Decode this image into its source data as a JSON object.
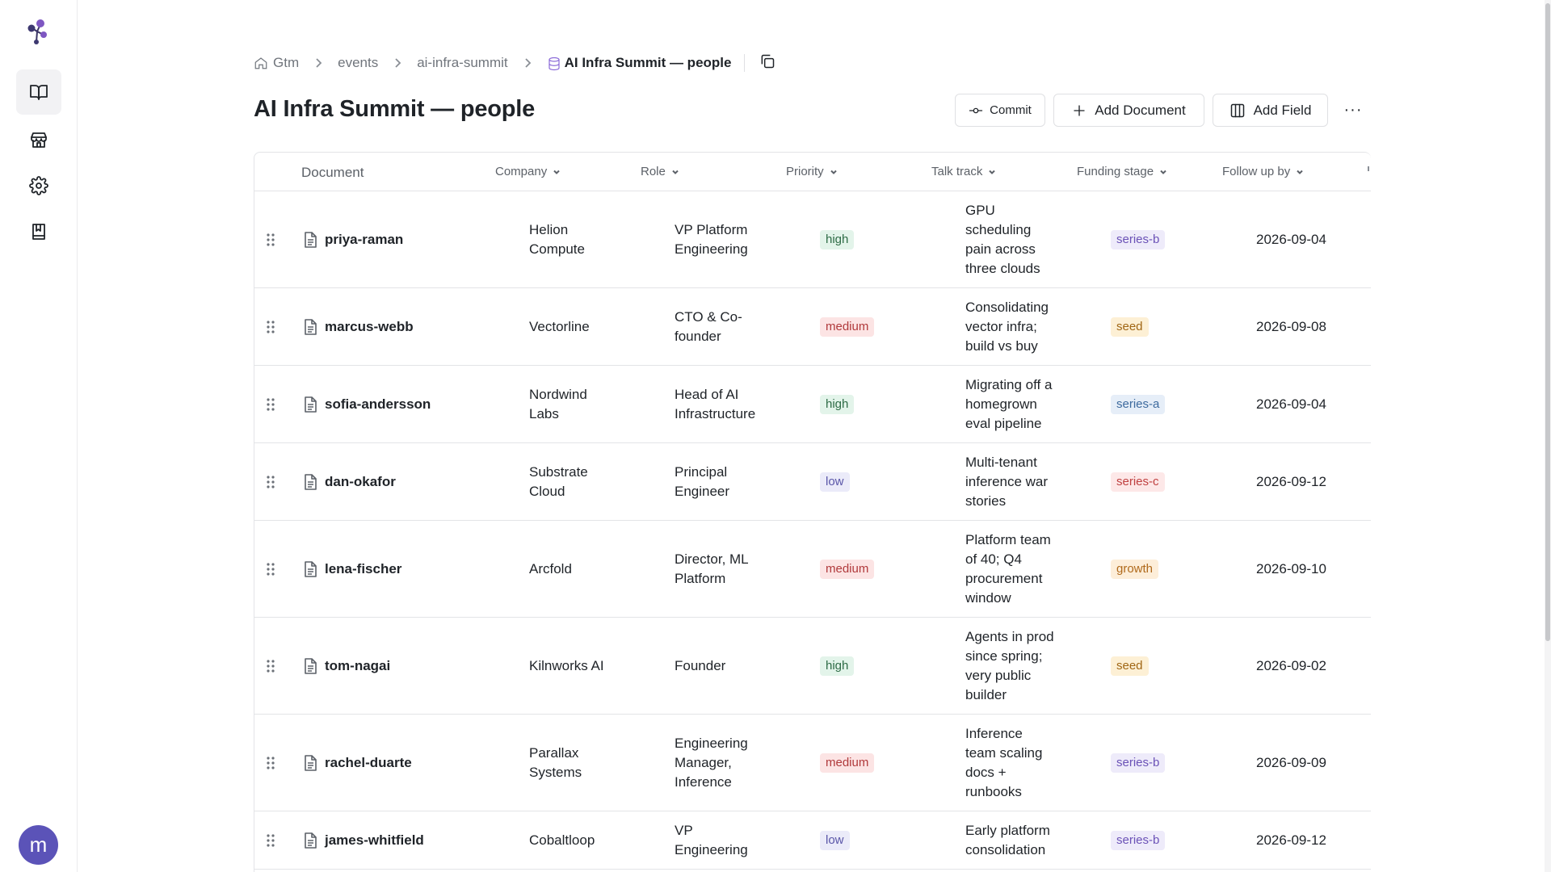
{
  "breadcrumb": {
    "items": [
      "Gtm",
      "events",
      "ai-infra-summit"
    ],
    "current": "AI Infra Summit — people"
  },
  "page": {
    "title": "AI Infra Summit — people"
  },
  "toolbar": {
    "commit_label": "Commit",
    "add_document_label": "Add Document",
    "add_field_label": "Add Field",
    "more_label": "···"
  },
  "user": {
    "avatar_initial": "m",
    "avatar_color": "#5b53b8"
  },
  "table": {
    "columns": [
      "Document",
      "Company",
      "Role",
      "Priority",
      "Talk track",
      "Funding stage",
      "Follow up by"
    ],
    "rows": [
      {
        "document": "priya-raman",
        "company": [
          "Helion",
          "Compute"
        ],
        "role": [
          "VP Platform",
          "Engineering"
        ],
        "priority": "high",
        "talk_track": [
          "GPU",
          "scheduling",
          "pain across",
          "three clouds"
        ],
        "funding_stage": "series-b",
        "follow_up_by": "2026-09-04"
      },
      {
        "document": "marcus-webb",
        "company": [
          "Vectorline"
        ],
        "role": [
          "CTO & Co-",
          "founder"
        ],
        "priority": "medium",
        "talk_track": [
          "Consolidating",
          "vector infra;",
          "build vs buy"
        ],
        "funding_stage": "seed",
        "follow_up_by": "2026-09-08"
      },
      {
        "document": "sofia-andersson",
        "company": [
          "Nordwind",
          "Labs"
        ],
        "role": [
          "Head of AI",
          "Infrastructure"
        ],
        "priority": "high",
        "talk_track": [
          "Migrating off a",
          "homegrown",
          "eval pipeline"
        ],
        "funding_stage": "series-a",
        "follow_up_by": "2026-09-04"
      },
      {
        "document": "dan-okafor",
        "company": [
          "Substrate",
          "Cloud"
        ],
        "role": [
          "Principal",
          "Engineer"
        ],
        "priority": "low",
        "talk_track": [
          "Multi-tenant",
          "inference war",
          "stories"
        ],
        "funding_stage": "series-c",
        "follow_up_by": "2026-09-12"
      },
      {
        "document": "lena-fischer",
        "company": [
          "Arcfold"
        ],
        "role": [
          "Director, ML",
          "Platform"
        ],
        "priority": "medium",
        "talk_track": [
          "Platform team",
          "of 40; Q4",
          "procurement",
          "window"
        ],
        "funding_stage": "growth",
        "follow_up_by": "2026-09-10"
      },
      {
        "document": "tom-nagai",
        "company": [
          "Kilnworks AI"
        ],
        "role": [
          "Founder"
        ],
        "priority": "high",
        "talk_track": [
          "Agents in prod",
          "since spring;",
          "very public",
          "builder"
        ],
        "funding_stage": "seed",
        "follow_up_by": "2026-09-02"
      },
      {
        "document": "rachel-duarte",
        "company": [
          "Parallax",
          "Systems"
        ],
        "role": [
          "Engineering",
          "Manager,",
          "Inference"
        ],
        "priority": "medium",
        "talk_track": [
          "Inference",
          "team scaling",
          "docs +",
          "runbooks"
        ],
        "funding_stage": "series-b",
        "follow_up_by": "2026-09-09"
      },
      {
        "document": "james-whitfield",
        "company": [
          "Cobaltloop"
        ],
        "role": [
          "VP",
          "Engineering"
        ],
        "priority": "low",
        "talk_track": [
          "Early platform",
          "consolidation"
        ],
        "funding_stage": "series-b",
        "follow_up_by": "2026-09-12"
      }
    ]
  }
}
